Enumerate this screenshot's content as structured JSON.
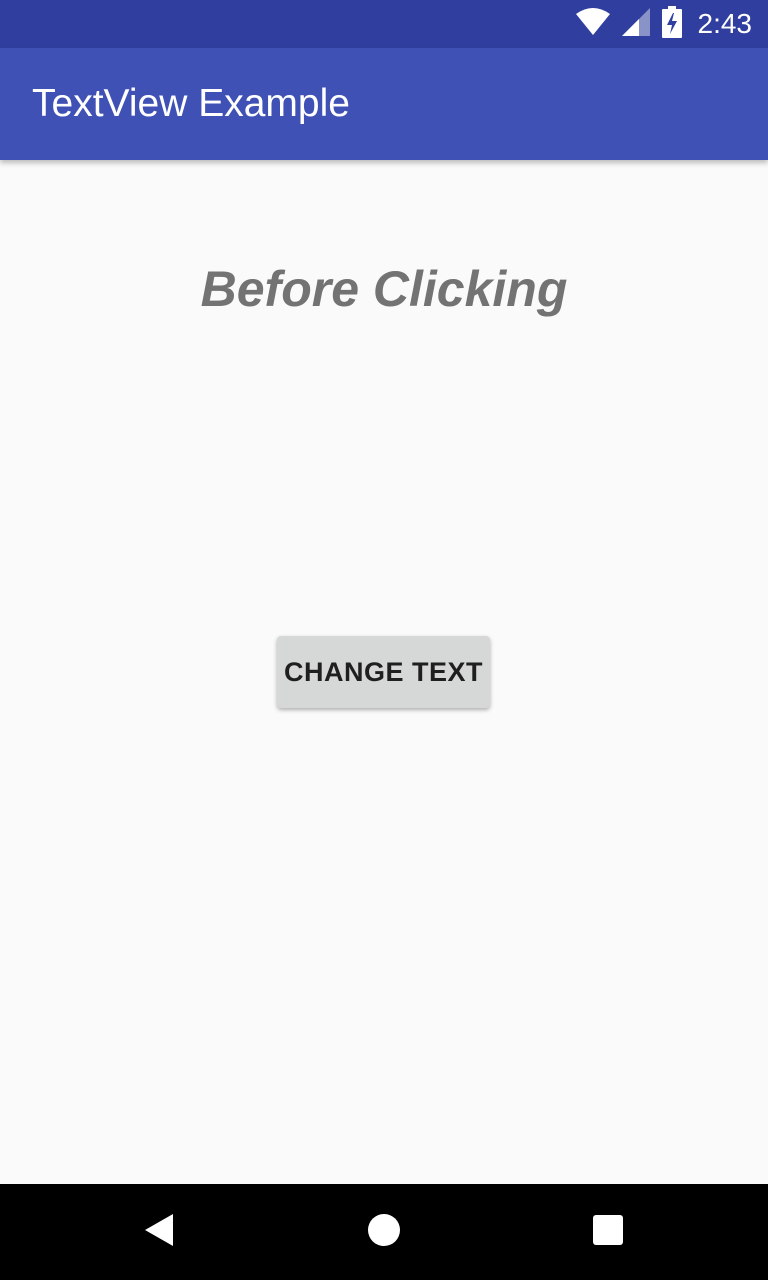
{
  "status_bar": {
    "time": "2:43",
    "icons": [
      "wifi-icon",
      "cell-signal-icon",
      "battery-charging-icon"
    ],
    "background_color": "#303f9f"
  },
  "app_bar": {
    "title": "TextView Example",
    "background_color": "#3f51b5"
  },
  "main": {
    "headline_text": "Before Clicking",
    "button_label": "CHANGE TEXT"
  },
  "nav_bar": {
    "icons": [
      "back-icon",
      "home-icon",
      "recents-icon"
    ]
  }
}
